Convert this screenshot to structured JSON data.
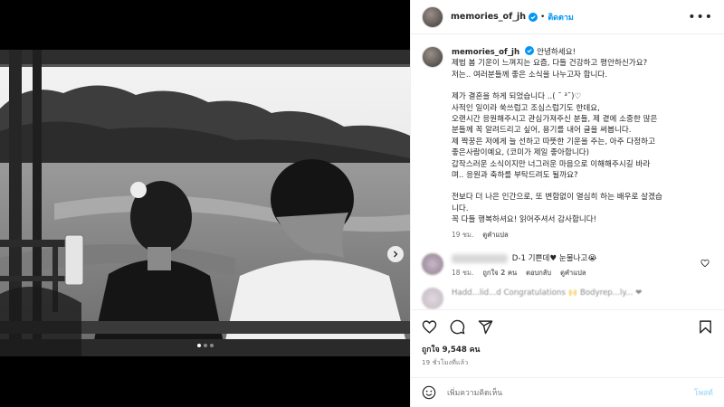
{
  "post": {
    "author": "memories_of_jh",
    "follow_label": "ติดตาม",
    "bullet": "•",
    "more_icon": "more-horizontal-icon",
    "carousel": {
      "current": 1,
      "total": 3
    }
  },
  "caption": {
    "lines_1": [
      "안녕하세요!",
      "제법 봄 기운이 느껴지는 요즘, 다들 건강하고 평안하신가요?",
      "저는.. 여러분들께 좋은 소식을 나누고자 합니다."
    ],
    "lines_2": [
      "제가 결혼을 하게 되었습니다 ..( ˘ ³˘)♡",
      "사적인 일이라 쑥쓰럽고 조심스럽기도 한데요,",
      "오랜시간 응원해주시고 관심가져주신 분들, 제 곁에 소중한 많은",
      "분들께 꼭 알려드리고 싶어, 용기를 내어 글을 써봅니다.",
      "제 짝꿍은 저에게 늘 선하고 따뜻한 기운을 주는, 아주 다정하고",
      "좋은사람이예요, (코미가 제일 좋아합니다)",
      "갑작스러운 소식이지만 너그러운 마음으로 이해해주시길 바라",
      "며.. 응원과 축하를 부탁드려도 될까요?"
    ],
    "lines_3": [
      "전보다 더 나은 인간으로, 또 변함없이 열심히 하는 배우로 살겠습",
      "니다.",
      "꼭 다들 행복하셔요! 읽어주셔서 감사합니다!"
    ],
    "time": "19 ชม.",
    "translate": "ดูคำแปล"
  },
  "comment": {
    "text": "D-1 기쁜데♥ 눈물나고😭",
    "time": "18 ชม.",
    "likes": "ถูกใจ 2 คน",
    "reply": "ตอบกลับ",
    "translate": "ดูคำแปล"
  },
  "faded_comment": {
    "text": "Hadd...lid...d Congratulations 🙌 Bodyrep...ly... ❤"
  },
  "actions": {
    "likes": "ถูกใจ 9,548 คน",
    "time": "19 ชั่วโมงที่แล้ว"
  },
  "add_comment": {
    "placeholder": "เพิ่มความคิดเห็น",
    "post_label": "โพสต์"
  },
  "colors": {
    "accent": "#0095f6",
    "verified": "#0095f6",
    "post_disabled": "#b2dffc"
  }
}
